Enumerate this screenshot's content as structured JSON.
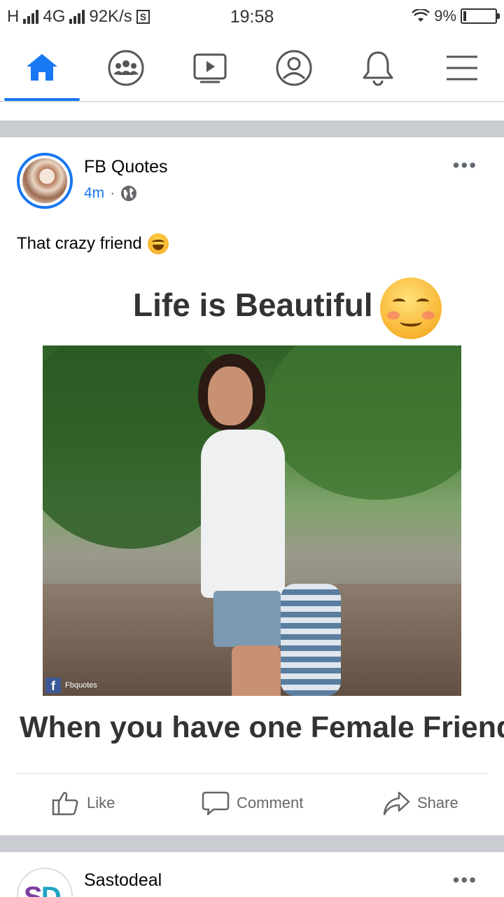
{
  "status_bar": {
    "network_left": "H",
    "network_type": "4G",
    "speed": "92K/s",
    "s_badge": "S",
    "time": "19:58",
    "battery": "9%"
  },
  "nav": {
    "tabs": [
      {
        "name": "home",
        "active": true
      },
      {
        "name": "groups",
        "active": false
      },
      {
        "name": "watch",
        "active": false
      },
      {
        "name": "profile",
        "active": false
      },
      {
        "name": "notifications",
        "active": false
      },
      {
        "name": "menu",
        "active": false
      }
    ],
    "accent": "#1877f2"
  },
  "post": {
    "page_name": "FB Quotes",
    "time": "4m",
    "separator": "·",
    "caption": "That crazy friend",
    "image_text_top": "Life is Beautiful",
    "image_text_bottom": "When you have one Female Friend",
    "watermark": "Fbquotes",
    "watermark_logo": "f",
    "more": "•••",
    "actions": {
      "like": "Like",
      "comment": "Comment",
      "share": "Share"
    }
  },
  "next_post": {
    "page_name": "Sastodeal",
    "avatar_text_a": "S",
    "avatar_text_b": "D",
    "more": "•••"
  }
}
